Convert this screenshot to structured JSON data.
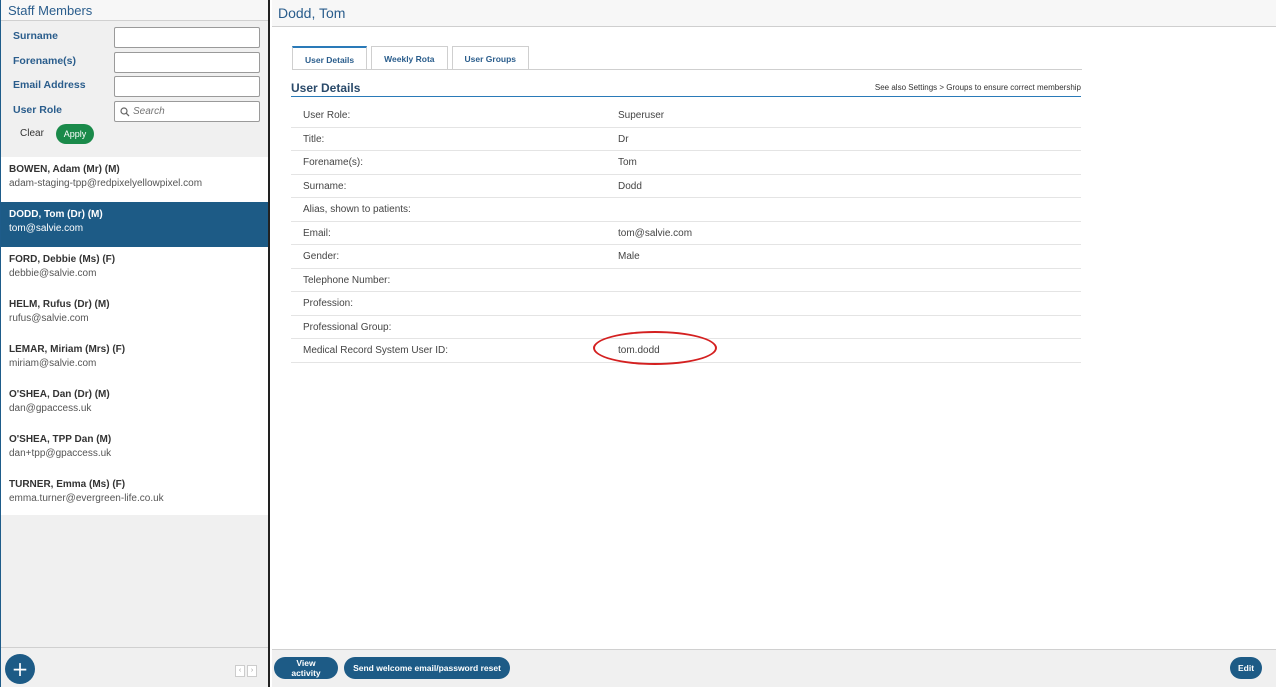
{
  "left_panel": {
    "title": "Staff Members",
    "filters": {
      "surname_label": "Surname",
      "forename_label": "Forename(s)",
      "email_label": "Email Address",
      "role_label": "User Role",
      "role_placeholder": "Search",
      "clear_label": "Clear",
      "apply_label": "Apply"
    },
    "staff": [
      {
        "name": "BOWEN, Adam (Mr) (M)",
        "email": "adam-staging-tpp@redpixelyellowpixel.com"
      },
      {
        "name": "DODD, Tom (Dr) (M)",
        "email": "tom@salvie.com"
      },
      {
        "name": "FORD, Debbie (Ms) (F)",
        "email": "debbie@salvie.com"
      },
      {
        "name": "HELM, Rufus (Dr) (M)",
        "email": "rufus@salvie.com"
      },
      {
        "name": "LEMAR, Miriam (Mrs) (F)",
        "email": "miriam@salvie.com"
      },
      {
        "name": "O'SHEA, Dan (Dr) (M)",
        "email": "dan@gpaccess.uk"
      },
      {
        "name": "O'SHEA, TPP Dan (M)",
        "email": "dan+tpp@gpaccess.uk"
      },
      {
        "name": "TURNER, Emma (Ms) (F)",
        "email": "emma.turner@evergreen-life.co.uk"
      }
    ],
    "add_label": "+",
    "pager_prev": "‹",
    "pager_next": "›"
  },
  "main": {
    "title": "Dodd, Tom",
    "tabs": [
      {
        "label": "User Details"
      },
      {
        "label": "Weekly Rota"
      },
      {
        "label": "User Groups"
      }
    ],
    "section_title": "User Details",
    "section_hint": "See also Settings > Groups to ensure correct membership",
    "details": [
      {
        "label": "User Role:",
        "value": "Superuser"
      },
      {
        "label": "Title:",
        "value": "Dr"
      },
      {
        "label": "Forename(s):",
        "value": "Tom"
      },
      {
        "label": "Surname:",
        "value": "Dodd"
      },
      {
        "label": "Alias, shown to patients:",
        "value": ""
      },
      {
        "label": "Email:",
        "value": "tom@salvie.com"
      },
      {
        "label": "Gender:",
        "value": "Male"
      },
      {
        "label": "Telephone Number:",
        "value": ""
      },
      {
        "label": "Profession:",
        "value": ""
      },
      {
        "label": "Professional Group:",
        "value": ""
      },
      {
        "label": "Medical Record System User ID:",
        "value": "tom.dodd"
      }
    ],
    "footer": {
      "view_activity": "View activity",
      "send_welcome": "Send welcome email/password reset",
      "edit": "Edit"
    }
  },
  "colors": {
    "accent": "#1d5b86",
    "apply_green": "#1a8a4a",
    "highlight_red": "#d42020"
  }
}
